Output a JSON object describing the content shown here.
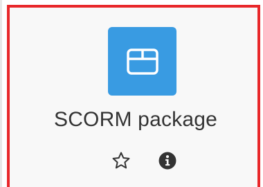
{
  "activity": {
    "name": "SCORM package",
    "icon": "package-box-icon",
    "icon_background": "#399be2",
    "highlight_border_color": "#e8272a"
  },
  "actions": {
    "star_icon": "star-outline-icon",
    "info_icon": "info-circle-icon"
  }
}
